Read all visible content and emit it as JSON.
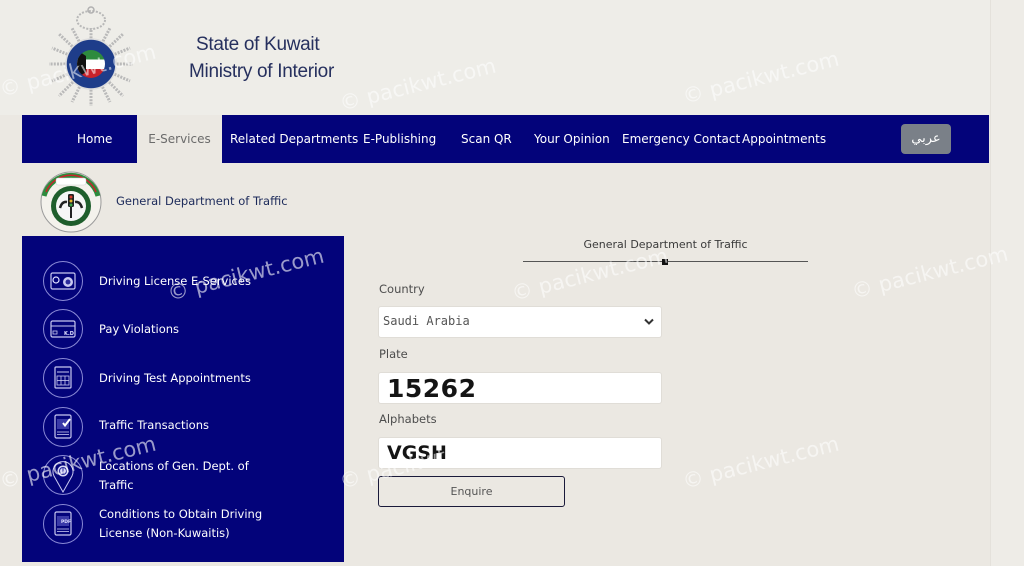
{
  "header": {
    "title_line1": "State of Kuwait",
    "title_line2": "Ministry of Interior",
    "logo": "kuwait-police-emblem"
  },
  "nav": {
    "items": [
      {
        "label": "Home",
        "active": false
      },
      {
        "label": "E-Services",
        "active": true
      },
      {
        "label": "Related Departments",
        "active": false
      },
      {
        "label": "E-Publishing",
        "active": false
      },
      {
        "label": "Scan QR",
        "active": false
      },
      {
        "label": "Your Opinion",
        "active": false
      },
      {
        "label": "Emergency Contact",
        "active": false
      },
      {
        "label": "Appointments",
        "active": false
      }
    ],
    "language_button": "عربي"
  },
  "department": {
    "name": "General Department of Traffic",
    "logo": "traffic-department-emblem"
  },
  "sidebar": {
    "items": [
      {
        "label": "Driving License E-Services",
        "icon": "license-card-icon"
      },
      {
        "label": "Pay Violations",
        "icon": "payment-card-icon",
        "icon_text": "K.D"
      },
      {
        "label": "Driving Test Appointments",
        "icon": "calendar-icon"
      },
      {
        "label": " Traffic Transactions",
        "icon": "document-check-icon"
      },
      {
        "label": " Locations of Gen. Dept. of Traffic",
        "icon": "location-pin-icon"
      },
      {
        "label": "Conditions to Obtain Driving License (Non-Kuwaitis)",
        "icon": "pdf-document-icon"
      }
    ]
  },
  "form": {
    "heading": "General Department of Traffic",
    "country_label": "Country",
    "country_value": "Saudi Arabia",
    "plate_label": "Plate",
    "plate_value": "15262",
    "alphabets_label": "Alphabets",
    "alphabets_value": "VGSH",
    "submit_label": "Enquire"
  },
  "watermark": {
    "text": "© pacikwt.com"
  },
  "colors": {
    "nav_bg": "#03037a",
    "page_bg": "#ebe8e2",
    "title_text": "#26305e",
    "lang_button_bg": "#7a8088"
  }
}
